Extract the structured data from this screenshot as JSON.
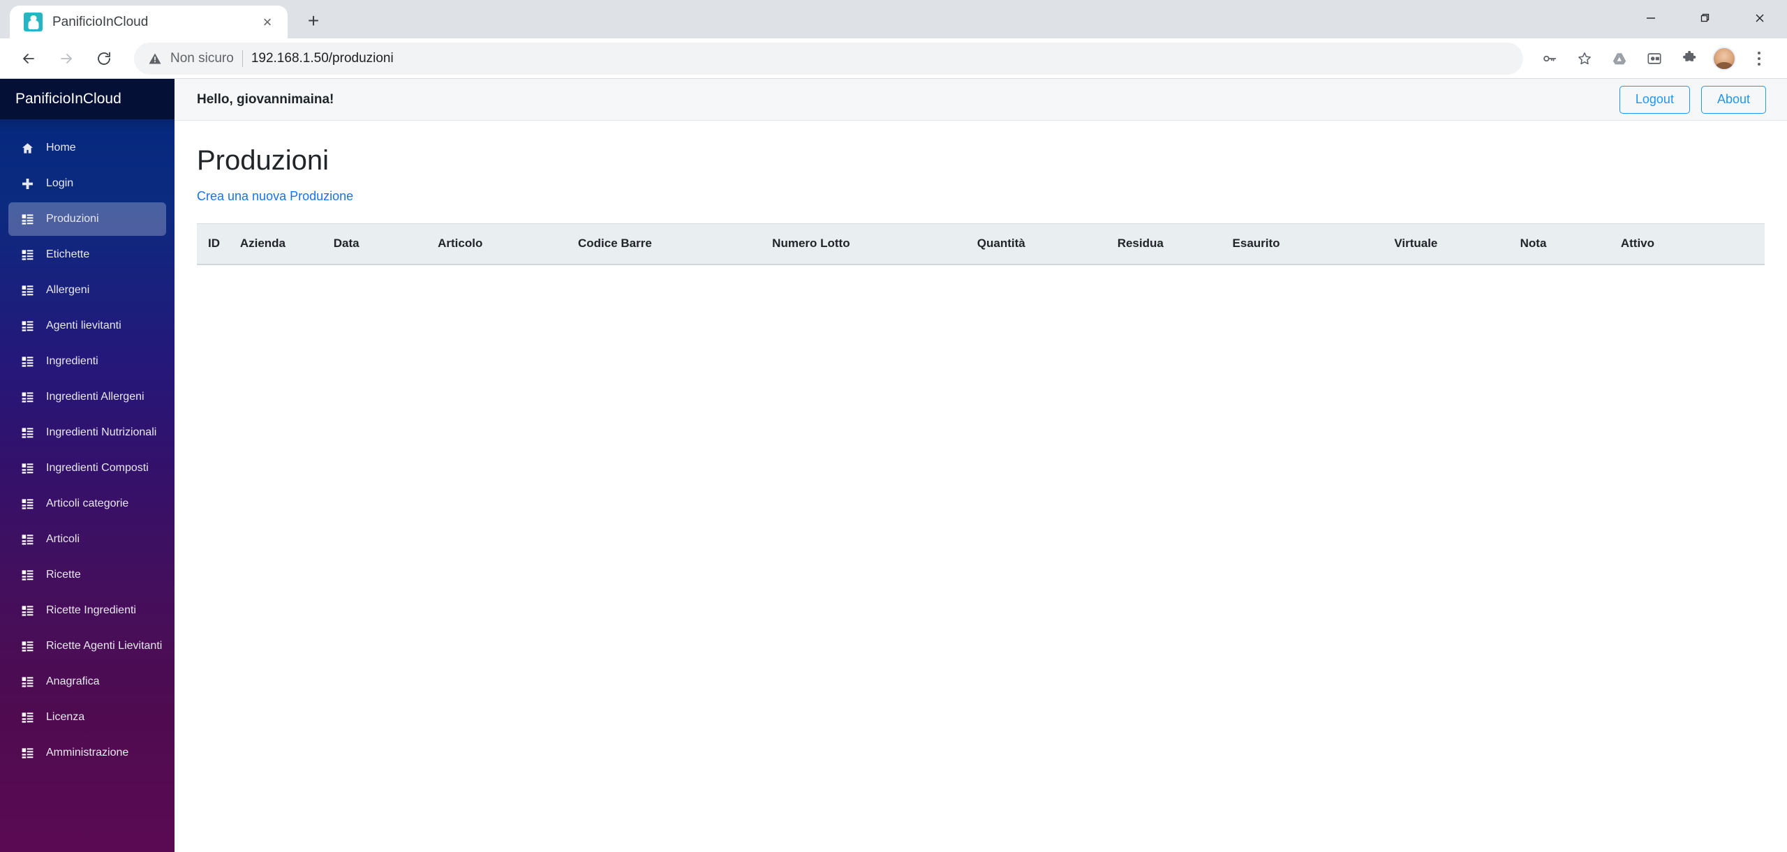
{
  "browser": {
    "tab": {
      "title": "PanificioInCloud",
      "favicon_name": "chef-favicon",
      "close_label": "×"
    },
    "new_tab_label": "+",
    "window_controls": {
      "minimize": "—",
      "restore": "❐",
      "close": "✕"
    },
    "nav": {
      "back": "back-arrow",
      "forward": "forward-arrow",
      "reload": "reload-arrow"
    },
    "omnibox": {
      "security_text": "Non sicuro",
      "url": "192.168.1.50/produzioni",
      "warning_icon": "warning-triangle-icon"
    },
    "toolbar_icons": [
      {
        "name": "password-key-icon"
      },
      {
        "name": "bookmark-star-icon"
      },
      {
        "name": "google-drive-icon"
      },
      {
        "name": "media-window-icon"
      },
      {
        "name": "extensions-puzzle-icon"
      },
      {
        "name": "profile-avatar"
      },
      {
        "name": "chrome-menu-icon"
      }
    ]
  },
  "sidebar": {
    "brand": "PanificioInCloud",
    "items": [
      {
        "label": "Home",
        "icon": "home-icon",
        "active": false
      },
      {
        "label": "Login",
        "icon": "plus-icon",
        "active": false
      },
      {
        "label": "Produzioni",
        "icon": "list-icon",
        "active": true
      },
      {
        "label": "Etichette",
        "icon": "list-icon",
        "active": false
      },
      {
        "label": "Allergeni",
        "icon": "list-icon",
        "active": false
      },
      {
        "label": "Agenti lievitanti",
        "icon": "list-icon",
        "active": false
      },
      {
        "label": "Ingredienti",
        "icon": "list-icon",
        "active": false
      },
      {
        "label": "Ingredienti Allergeni",
        "icon": "list-icon",
        "active": false
      },
      {
        "label": "Ingredienti Nutrizionali",
        "icon": "list-icon",
        "active": false
      },
      {
        "label": "Ingredienti Composti",
        "icon": "list-icon",
        "active": false
      },
      {
        "label": "Articoli categorie",
        "icon": "list-icon",
        "active": false
      },
      {
        "label": "Articoli",
        "icon": "list-icon",
        "active": false
      },
      {
        "label": "Ricette",
        "icon": "list-icon",
        "active": false
      },
      {
        "label": "Ricette Ingredienti",
        "icon": "list-icon",
        "active": false
      },
      {
        "label": "Ricette Agenti Lievitanti",
        "icon": "list-icon",
        "active": false
      },
      {
        "label": "Anagrafica",
        "icon": "list-icon",
        "active": false
      },
      {
        "label": "Licenza",
        "icon": "list-icon",
        "active": false
      },
      {
        "label": "Amministrazione",
        "icon": "list-icon",
        "active": false
      }
    ]
  },
  "topbar": {
    "greeting": "Hello, giovannimaina!",
    "logout_label": "Logout",
    "about_label": "About"
  },
  "main": {
    "title": "Produzioni",
    "create_link": "Crea una nuova Produzione",
    "table": {
      "columns": [
        "ID",
        "Azienda",
        "Data",
        "Articolo",
        "Codice Barre",
        "Numero Lotto",
        "Quantità",
        "Residua",
        "Esaurito",
        "Virtuale",
        "Nota",
        "Attivo"
      ],
      "rows": []
    }
  },
  "colors": {
    "accent_blue": "#2196f3",
    "link_blue": "#1a73e8",
    "sidebar_top": "#061740",
    "sidebar_bottom": "#5a0a52",
    "table_header_bg": "#e9eef1"
  }
}
